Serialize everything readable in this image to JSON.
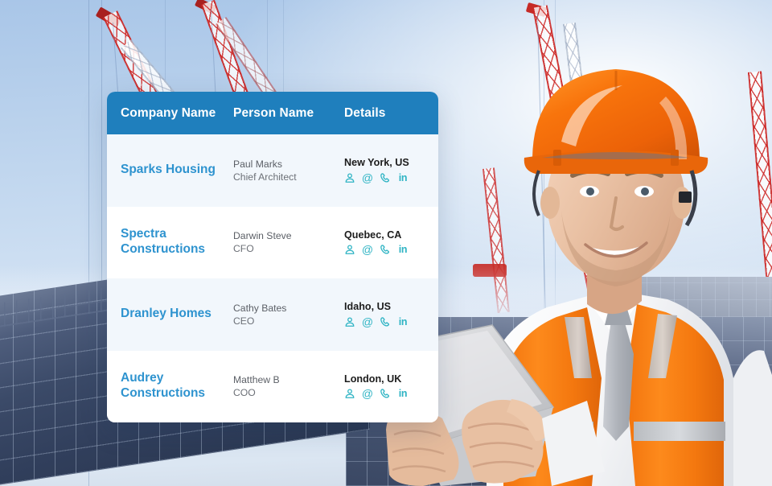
{
  "table": {
    "headers": {
      "company": "Company Name",
      "person": "Person Name",
      "details": "Details"
    },
    "header_bg": "#1f7fbd",
    "link_color": "#2e93cf",
    "icon_color": "#2fb4c4",
    "rows": [
      {
        "company": "Sparks Housing",
        "person_name": "Paul Marks",
        "person_role": "Chief Architect",
        "location": "New York, US",
        "icons": [
          "contact-card-icon",
          "email-icon",
          "phone-icon",
          "linkedin-icon"
        ]
      },
      {
        "company": "Spectra Constructions",
        "person_name": "Darwin Steve",
        "person_role": "CFO",
        "location": "Quebec, CA",
        "icons": [
          "contact-card-icon",
          "email-icon",
          "phone-icon",
          "linkedin-icon"
        ]
      },
      {
        "company": "Dranley Homes",
        "person_name": "Cathy Bates",
        "person_role": "CEO",
        "location": "Idaho, US",
        "icons": [
          "contact-card-icon",
          "email-icon",
          "phone-icon",
          "linkedin-icon"
        ]
      },
      {
        "company": "Audrey Constructions",
        "person_name": "Matthew B",
        "person_role": "COO",
        "location": "London, UK",
        "icons": [
          "contact-card-icon",
          "email-icon",
          "phone-icon",
          "linkedin-icon"
        ]
      }
    ],
    "icon_glyphs": {
      "email": "@",
      "linkedin": "in"
    }
  },
  "scene": {
    "sky_color": "#c2d8ef",
    "crane_color": "#c62a26",
    "building_color": "#3b4a68",
    "helmet_color": "#f4700f",
    "vest_color": "#fb7a12",
    "shirt_color": "#ffffff",
    "tie_color": "#b9bcc2",
    "tablet_color": "#d6d7d9"
  }
}
